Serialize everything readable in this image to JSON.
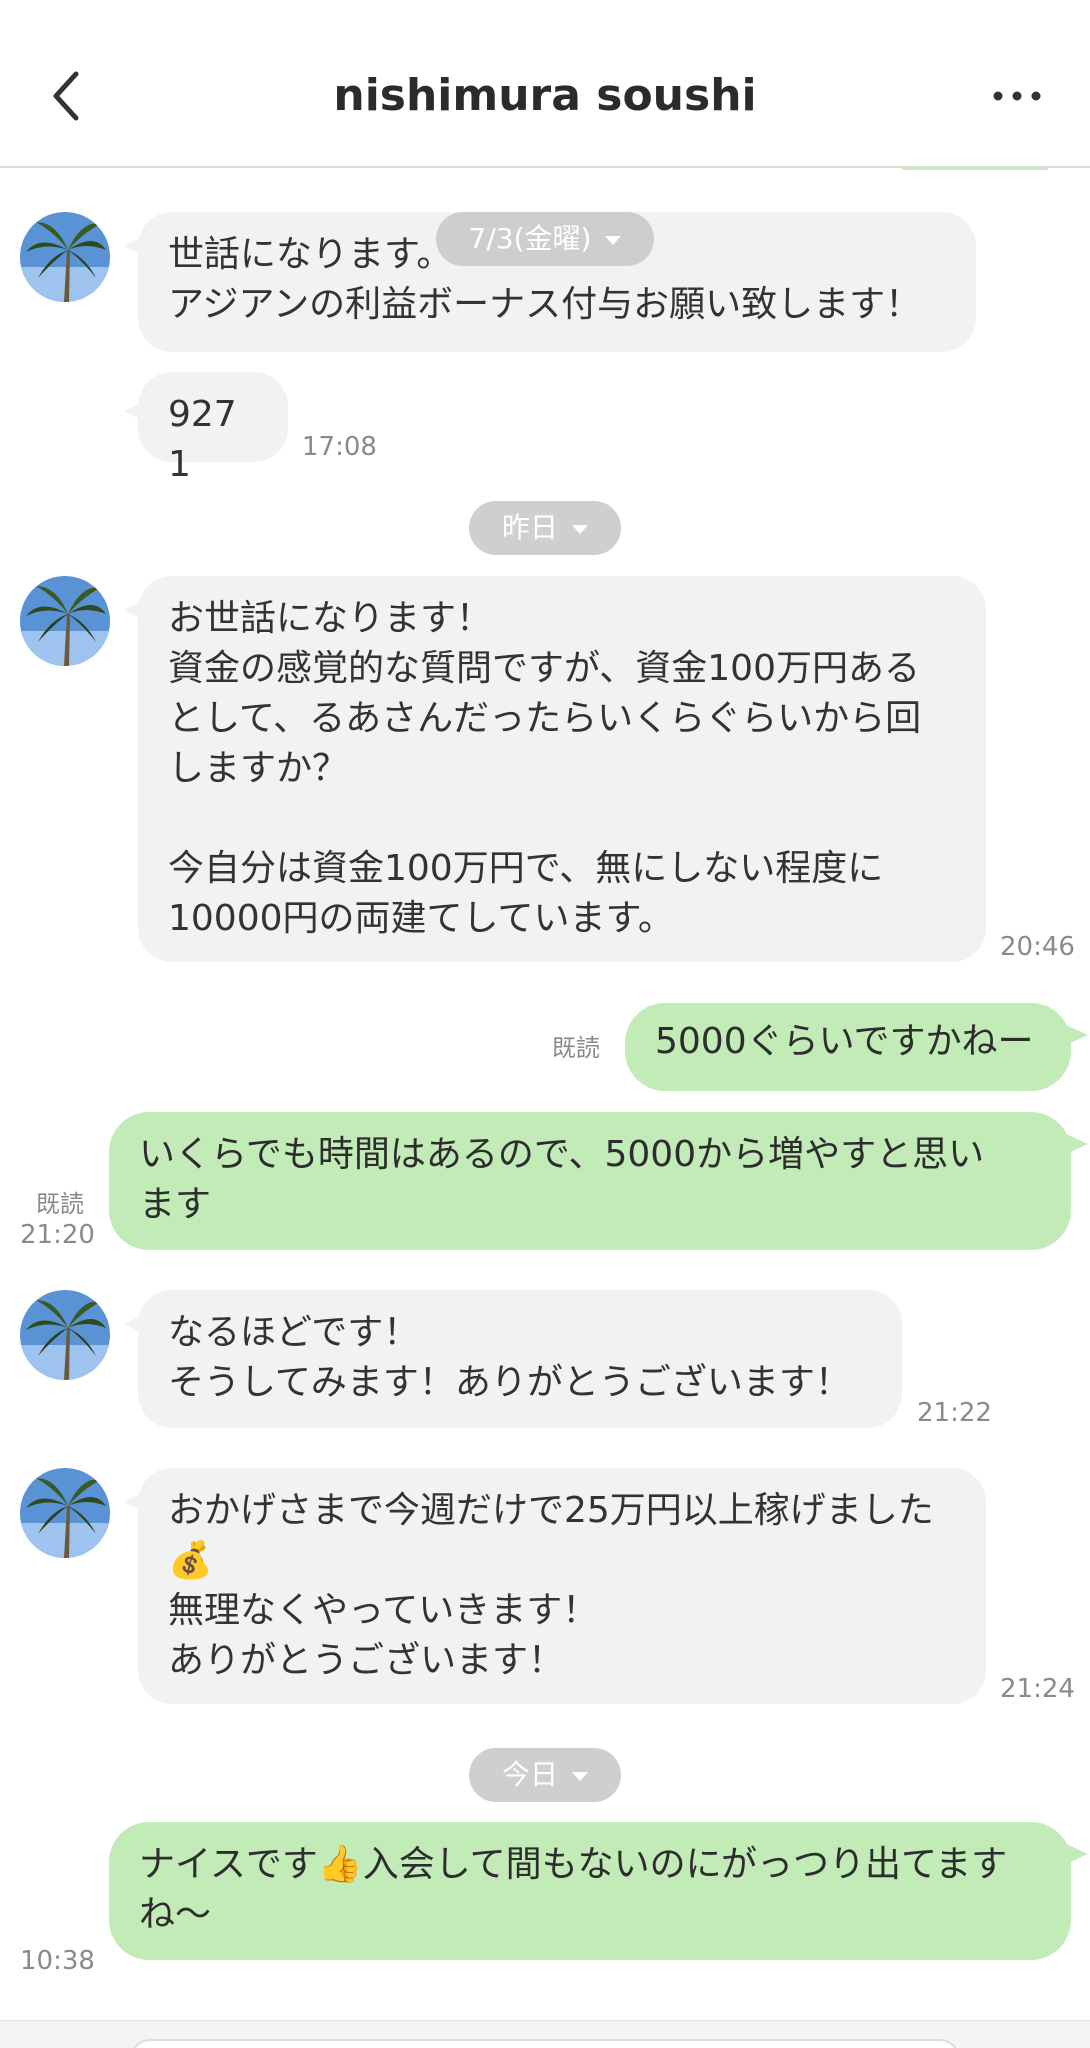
{
  "header": {
    "title": "nishimura soushi",
    "back_icon": "chevron-left-icon",
    "more_icon": "more-dots-icon"
  },
  "colors": {
    "incoming_bubble": "#f1f2f4",
    "outgoing_bubble": "#c2ebb8",
    "date_pill": "#cfcfcf"
  },
  "dates": {
    "first": "7/3(金曜)",
    "yesterday": "昨日",
    "today": "今日"
  },
  "messages": [
    {
      "dir": "in",
      "text": "世話になります。\nアジアンの利益ボーナス付与お願い致します！"
    },
    {
      "dir": "in",
      "text": "9271",
      "time": "17:08"
    },
    {
      "dir": "in",
      "text": "お世話になります！\n資金の感覚的な質問ですが、資金100万円ある\nとして、るあさんだったらいくらぐらいから回\nしますか？\n\n今自分は資金100万円で、無にしない程度に\n10000円の両建てしています。",
      "time": "20:46"
    },
    {
      "dir": "out",
      "text": "5000ぐらいですかねー",
      "read": "既読"
    },
    {
      "dir": "out",
      "text": "いくらでも時間はあるので、5000から増やすと思い\nます",
      "read": "既読",
      "time": "21:20"
    },
    {
      "dir": "in",
      "text": "なるほどです！\nそうしてみます！ありがとうございます！",
      "time": "21:22"
    },
    {
      "dir": "in",
      "text": "おかげさまで今週だけで25万円以上稼げました\n💰\n無理なくやっていきます！\nありがとうございます！",
      "time": "21:24"
    },
    {
      "dir": "out",
      "text": "ナイスです👍入会して間もないのにがっつり出てます\nね〜",
      "time": "10:38"
    }
  ]
}
